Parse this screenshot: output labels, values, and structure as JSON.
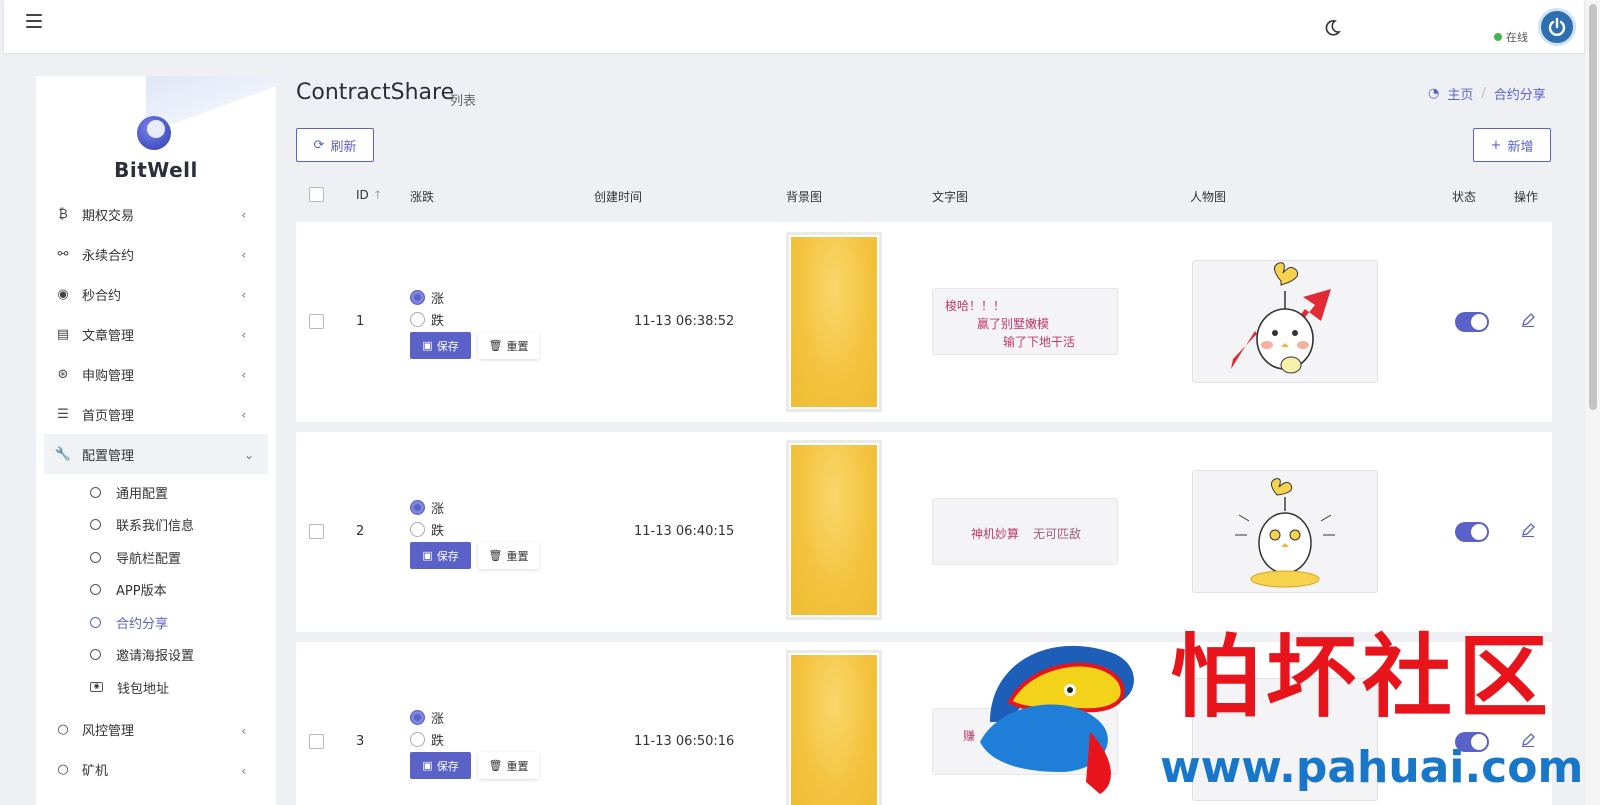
{
  "topbar": {
    "online_label": "在线"
  },
  "sidebar": {
    "brand": "BitWell",
    "menu": [
      {
        "label": "期权交易",
        "icon": "bitcoin-icon"
      },
      {
        "label": "永续合约",
        "icon": "link-icon"
      },
      {
        "label": "秒合约",
        "icon": "dot-circle-icon"
      },
      {
        "label": "文章管理",
        "icon": "newspaper-icon"
      },
      {
        "label": "申购管理",
        "icon": "lifebuoy-icon"
      },
      {
        "label": "首页管理",
        "icon": "list-icon"
      },
      {
        "label": "配置管理",
        "icon": "wrench-icon"
      }
    ],
    "submenu": [
      {
        "label": "通用配置"
      },
      {
        "label": "联系我们信息"
      },
      {
        "label": "导航栏配置"
      },
      {
        "label": "APP版本"
      },
      {
        "label": "合约分享"
      },
      {
        "label": "邀请海报设置"
      },
      {
        "label": "钱包地址"
      }
    ],
    "menu_after": [
      {
        "label": "风控管理"
      },
      {
        "label": "矿机"
      }
    ]
  },
  "header": {
    "title": "ContractShare",
    "subtitle": "列表",
    "breadcrumb": {
      "home": "主页",
      "current": "合约分享"
    },
    "refresh_label": "刷新",
    "add_label": "新增"
  },
  "table": {
    "columns": {
      "id": "ID",
      "rise_fall": "涨跌",
      "created": "创建时间",
      "background": "背景图",
      "text_image": "文字图",
      "character": "人物图",
      "status": "状态",
      "actions": "操作"
    },
    "option_up": "涨",
    "option_down": "跌",
    "save_label": "保存",
    "reset_label": "重置",
    "rows": [
      {
        "id": "1",
        "selected": "涨",
        "created": "11-13 06:38:52",
        "text_lines": [
          "梭哈！！！",
          "赢了别墅嫩模",
          "输了下地干活"
        ],
        "status_on": true
      },
      {
        "id": "2",
        "selected": "涨",
        "created": "11-13 06:40:15",
        "text_lines": [
          "神机妙算",
          "无可匹敌"
        ],
        "status_on": true
      },
      {
        "id": "3",
        "selected": "涨",
        "created": "11-13 06:50:16",
        "text_lines": [
          "赚"
        ],
        "status_on": true
      }
    ]
  },
  "watermark": {
    "text": "怕坏社区",
    "url": "www.pahuai.com"
  },
  "colors": {
    "accent": "#5a62c8",
    "online": "#4caf50",
    "watermark_red": "#e8141c",
    "watermark_blue": "#1877c9"
  }
}
